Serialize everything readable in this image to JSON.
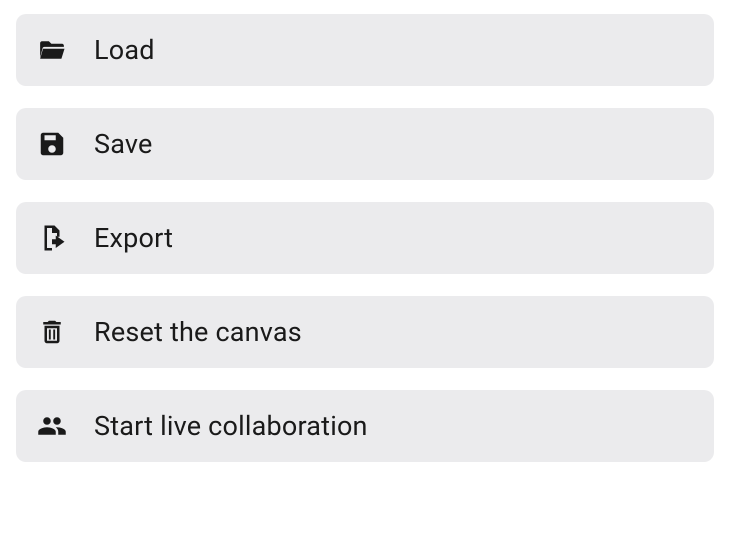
{
  "menu": {
    "items": [
      {
        "label": "Load"
      },
      {
        "label": "Save"
      },
      {
        "label": "Export"
      },
      {
        "label": "Reset the canvas"
      },
      {
        "label": "Start live collaboration"
      }
    ]
  }
}
